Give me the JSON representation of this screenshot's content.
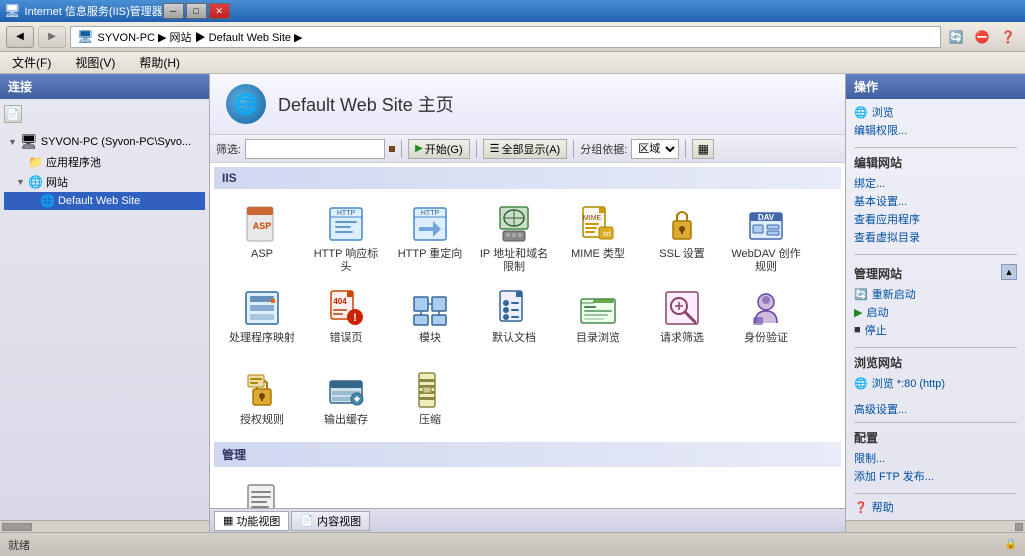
{
  "titlebar": {
    "title": "Internet 信息服务(IIS)管理器",
    "min": "─",
    "max": "□",
    "close": "✕"
  },
  "addressbar": {
    "path": "SYVON-PC ▶ 网站 ▶ Default Web Site ▶",
    "back": "◀",
    "forward": "▶"
  },
  "menubar": {
    "items": [
      "文件(F)",
      "视图(V)",
      "帮助(H)"
    ]
  },
  "sidebar": {
    "header": "连接",
    "tree": [
      {
        "id": "root",
        "label": "SYVON-PC (Syvon-PC\\Syvo...",
        "indent": 0,
        "expand": "▼",
        "icon": "🖥"
      },
      {
        "id": "apppool",
        "label": "应用程序池",
        "indent": 1,
        "expand": "",
        "icon": "📁"
      },
      {
        "id": "sites",
        "label": "网站",
        "indent": 1,
        "expand": "▼",
        "icon": "🌐"
      },
      {
        "id": "default",
        "label": "Default Web Site",
        "indent": 2,
        "expand": "",
        "icon": "🌐",
        "selected": true
      }
    ]
  },
  "content": {
    "title": "Default Web Site 主页",
    "icon": "🌐",
    "toolbar": {
      "filter_label": "筛选:",
      "filter_placeholder": "",
      "start_btn": "▶ 开始(G)",
      "show_all_btn": "☰ 全部显示(A)",
      "groupby_label": "分组依据:",
      "groupby_value": "区域",
      "view_btn": "▦"
    },
    "sections": [
      {
        "id": "iis",
        "header": "IIS",
        "icons": [
          {
            "id": "asp",
            "label": "ASP",
            "icon": "📄",
            "color": "#cc4400"
          },
          {
            "id": "http-resp",
            "label": "HTTP 响应标头",
            "icon": "📋",
            "color": "#4488cc"
          },
          {
            "id": "http-redir",
            "label": "HTTP 重定向",
            "icon": "↩",
            "color": "#4488cc"
          },
          {
            "id": "ip",
            "label": "IP 地址和域名限制",
            "icon": "🔒",
            "color": "#226644"
          },
          {
            "id": "mime",
            "label": "MIME 类型",
            "icon": "📑",
            "color": "#884400"
          },
          {
            "id": "ssl",
            "label": "SSL 设置",
            "icon": "🔒",
            "color": "#cc8800"
          },
          {
            "id": "webdav",
            "label": "WebDAV 创作规则",
            "icon": "📂",
            "color": "#4466aa"
          },
          {
            "id": "handler",
            "label": "处理程序映射",
            "icon": "⚙",
            "color": "#336699"
          },
          {
            "id": "error",
            "label": "错误页",
            "icon": "⚠",
            "color": "#cc2200"
          },
          {
            "id": "module",
            "label": "模块",
            "icon": "🧩",
            "color": "#226699"
          },
          {
            "id": "default-doc",
            "label": "默认文档",
            "icon": "📄",
            "color": "#336699"
          },
          {
            "id": "dir-browse",
            "label": "目录浏览",
            "icon": "📁",
            "color": "#448844"
          },
          {
            "id": "req-filter",
            "label": "请求筛选",
            "icon": "🔍",
            "color": "#884466"
          },
          {
            "id": "auth",
            "label": "身份验证",
            "icon": "👤",
            "color": "#6644aa"
          }
        ]
      },
      {
        "id": "iis2",
        "header": "",
        "icons": [
          {
            "id": "authz",
            "label": "授权规则",
            "icon": "🔑",
            "color": "#cc8800"
          },
          {
            "id": "output",
            "label": "输出缓存",
            "icon": "💾",
            "color": "#336688"
          },
          {
            "id": "compress",
            "label": "压缩",
            "icon": "📦",
            "color": "#888844"
          }
        ]
      },
      {
        "id": "manage",
        "header": "管理",
        "icons": [
          {
            "id": "manage-txt",
            "label": "",
            "icon": "📋",
            "color": "#444"
          }
        ]
      }
    ],
    "tabs": [
      {
        "id": "feature-view",
        "label": "功能视图",
        "icon": "▦"
      },
      {
        "id": "content-view",
        "label": "内容视图",
        "icon": "📄"
      }
    ]
  },
  "rightpanel": {
    "header": "操作",
    "sections": [
      {
        "id": "browse",
        "links": [
          {
            "id": "browse",
            "label": "浏览",
            "icon": "🌐"
          },
          {
            "id": "edit-perms",
            "label": "编辑权限...",
            "icon": ""
          }
        ]
      },
      {
        "id": "edit-site",
        "title": "编辑网站",
        "links": [
          {
            "id": "bind",
            "label": "绑定...",
            "icon": ""
          },
          {
            "id": "basic-settings",
            "label": "基本设置...",
            "icon": ""
          },
          {
            "id": "view-app",
            "label": "查看应用程序",
            "icon": ""
          },
          {
            "id": "view-vdir",
            "label": "查看虚拟目录",
            "icon": ""
          }
        ]
      },
      {
        "id": "manage-site",
        "title": "管理网站",
        "links": [
          {
            "id": "restart",
            "label": "重新启动",
            "icon": "🔄"
          },
          {
            "id": "start",
            "label": "启动",
            "icon": "▶"
          },
          {
            "id": "stop",
            "label": "停止",
            "icon": "■"
          }
        ]
      },
      {
        "id": "browse-site",
        "title": "浏览网站",
        "links": [
          {
            "id": "browse-80",
            "label": "浏览 *:80 (http)",
            "icon": "🌐"
          }
        ]
      },
      {
        "id": "advanced",
        "links": [
          {
            "id": "advanced-settings",
            "label": "高级设置...",
            "icon": ""
          }
        ]
      },
      {
        "id": "config",
        "title": "配置",
        "links": [
          {
            "id": "limit",
            "label": "限制...",
            "icon": ""
          },
          {
            "id": "add-ftp",
            "label": "添加 FTP 发布...",
            "icon": ""
          }
        ]
      },
      {
        "id": "help",
        "links": [
          {
            "id": "help",
            "label": "帮助",
            "icon": "❓"
          }
        ]
      }
    ]
  },
  "statusbar": {
    "text": "就绪"
  }
}
